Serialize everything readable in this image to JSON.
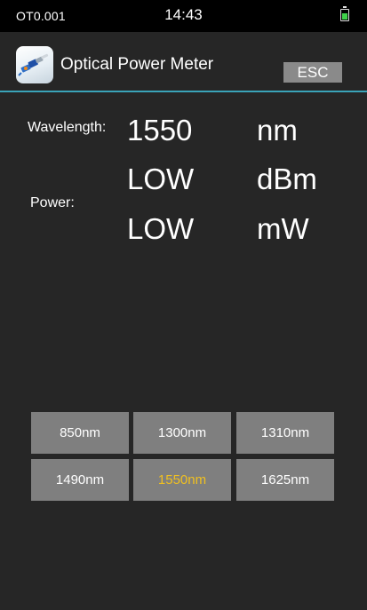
{
  "status_bar": {
    "device_id": "OT0.001",
    "time": "14:43",
    "battery_icon": "battery-icon",
    "battery_color": "#3fd14a"
  },
  "header": {
    "app_icon": "optical-fiber-connector-icon",
    "title": "Optical Power Meter",
    "esc_label": "ESC",
    "accent_color": "#3aa3b8"
  },
  "readout": {
    "wavelength_label": "Wavelength:",
    "wavelength_value": "1550",
    "wavelength_unit": "nm",
    "power_label": "Power:",
    "power_dbm_value": "LOW",
    "power_dbm_unit": "dBm",
    "power_mw_value": "LOW",
    "power_mw_unit": "mW"
  },
  "wavelength_buttons": [
    {
      "label": "850nm"
    },
    {
      "label": "1300nm"
    },
    {
      "label": "1310nm"
    },
    {
      "label": "1490nm"
    },
    {
      "label": "1550nm"
    },
    {
      "label": "1625nm"
    }
  ],
  "selected_wavelength": "1550nm",
  "selected_color": "#f0c020"
}
